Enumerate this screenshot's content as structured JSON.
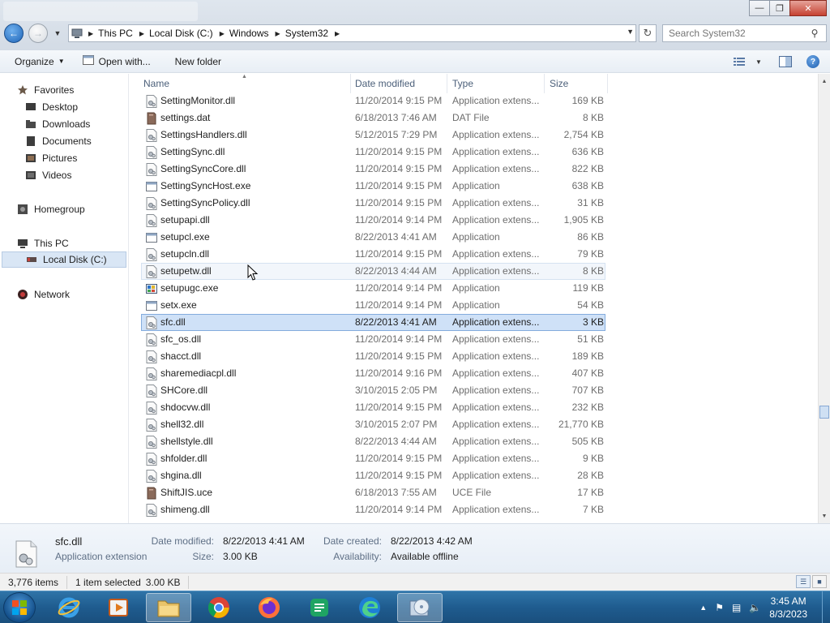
{
  "window": {
    "controls": {
      "minimize": "—",
      "maximize": "❐",
      "close": "✕"
    }
  },
  "address": {
    "crumbs": [
      "This PC",
      "Local Disk (C:)",
      "Windows",
      "System32"
    ]
  },
  "search": {
    "placeholder": "Search System32"
  },
  "toolbar": {
    "organize": "Organize",
    "open_with": "Open with...",
    "new_folder": "New folder"
  },
  "nav": {
    "favorites": "Favorites",
    "desktop": "Desktop",
    "downloads": "Downloads",
    "documents": "Documents",
    "pictures": "Pictures",
    "videos": "Videos",
    "homegroup": "Homegroup",
    "this_pc": "This PC",
    "local_disk": "Local Disk (C:)",
    "network": "Network"
  },
  "columns": {
    "name": "Name",
    "date": "Date modified",
    "type": "Type",
    "size": "Size"
  },
  "files": [
    {
      "name": "SettingMonitor.dll",
      "date": "11/20/2014 9:15 PM",
      "type": "Application extens...",
      "size": "169 KB",
      "icon": "dll"
    },
    {
      "name": "settings.dat",
      "date": "6/18/2013 7:46 AM",
      "type": "DAT File",
      "size": "8 KB",
      "icon": "dat"
    },
    {
      "name": "SettingsHandlers.dll",
      "date": "5/12/2015 7:29 PM",
      "type": "Application extens...",
      "size": "2,754 KB",
      "icon": "dll"
    },
    {
      "name": "SettingSync.dll",
      "date": "11/20/2014 9:15 PM",
      "type": "Application extens...",
      "size": "636 KB",
      "icon": "dll"
    },
    {
      "name": "SettingSyncCore.dll",
      "date": "11/20/2014 9:15 PM",
      "type": "Application extens...",
      "size": "822 KB",
      "icon": "dll"
    },
    {
      "name": "SettingSyncHost.exe",
      "date": "11/20/2014 9:15 PM",
      "type": "Application",
      "size": "638 KB",
      "icon": "exe"
    },
    {
      "name": "SettingSyncPolicy.dll",
      "date": "11/20/2014 9:15 PM",
      "type": "Application extens...",
      "size": "31 KB",
      "icon": "dll"
    },
    {
      "name": "setupapi.dll",
      "date": "11/20/2014 9:14 PM",
      "type": "Application extens...",
      "size": "1,905 KB",
      "icon": "dll"
    },
    {
      "name": "setupcl.exe",
      "date": "8/22/2013 4:41 AM",
      "type": "Application",
      "size": "86 KB",
      "icon": "exe"
    },
    {
      "name": "setupcln.dll",
      "date": "11/20/2014 9:15 PM",
      "type": "Application extens...",
      "size": "79 KB",
      "icon": "dll"
    },
    {
      "name": "setupetw.dll",
      "date": "8/22/2013 4:44 AM",
      "type": "Application extens...",
      "size": "8 KB",
      "icon": "dll",
      "state": "hover"
    },
    {
      "name": "setupugc.exe",
      "date": "11/20/2014 9:14 PM",
      "type": "Application",
      "size": "119 KB",
      "icon": "exe-color"
    },
    {
      "name": "setx.exe",
      "date": "11/20/2014 9:14 PM",
      "type": "Application",
      "size": "54 KB",
      "icon": "exe"
    },
    {
      "name": "sfc.dll",
      "date": "8/22/2013 4:41 AM",
      "type": "Application extens...",
      "size": "3 KB",
      "icon": "dll",
      "state": "selected"
    },
    {
      "name": "sfc_os.dll",
      "date": "11/20/2014 9:14 PM",
      "type": "Application extens...",
      "size": "51 KB",
      "icon": "dll"
    },
    {
      "name": "shacct.dll",
      "date": "11/20/2014 9:15 PM",
      "type": "Application extens...",
      "size": "189 KB",
      "icon": "dll"
    },
    {
      "name": "sharemediacpl.dll",
      "date": "11/20/2014 9:16 PM",
      "type": "Application extens...",
      "size": "407 KB",
      "icon": "dll"
    },
    {
      "name": "SHCore.dll",
      "date": "3/10/2015 2:05 PM",
      "type": "Application extens...",
      "size": "707 KB",
      "icon": "dll"
    },
    {
      "name": "shdocvw.dll",
      "date": "11/20/2014 9:15 PM",
      "type": "Application extens...",
      "size": "232 KB",
      "icon": "dll"
    },
    {
      "name": "shell32.dll",
      "date": "3/10/2015 2:07 PM",
      "type": "Application extens...",
      "size": "21,770 KB",
      "icon": "dll"
    },
    {
      "name": "shellstyle.dll",
      "date": "8/22/2013 4:44 AM",
      "type": "Application extens...",
      "size": "505 KB",
      "icon": "dll"
    },
    {
      "name": "shfolder.dll",
      "date": "11/20/2014 9:15 PM",
      "type": "Application extens...",
      "size": "9 KB",
      "icon": "dll"
    },
    {
      "name": "shgina.dll",
      "date": "11/20/2014 9:15 PM",
      "type": "Application extens...",
      "size": "28 KB",
      "icon": "dll"
    },
    {
      "name": "ShiftJIS.uce",
      "date": "6/18/2013 7:55 AM",
      "type": "UCE File",
      "size": "17 KB",
      "icon": "dat"
    },
    {
      "name": "shimeng.dll",
      "date": "11/20/2014 9:14 PM",
      "type": "Application extens...",
      "size": "7 KB",
      "icon": "dll"
    }
  ],
  "details": {
    "name": "sfc.dll",
    "kind": "Application extension",
    "date_modified_label": "Date modified:",
    "date_modified": "8/22/2013 4:41 AM",
    "size_label": "Size:",
    "size": "3.00 KB",
    "date_created_label": "Date created:",
    "date_created": "8/22/2013 4:42 AM",
    "availability_label": "Availability:",
    "availability": "Available offline"
  },
  "status": {
    "items": "3,776 items",
    "selected": "1 item selected",
    "selected_size": "3.00 KB"
  },
  "taskbar": {
    "time": "3:45 AM",
    "date": "8/3/2023"
  },
  "colors": {
    "selection": "#cfe1f7",
    "selection_border": "#84acdd",
    "taskbar": "#1f5c8f",
    "header_text": "#4c607a"
  }
}
